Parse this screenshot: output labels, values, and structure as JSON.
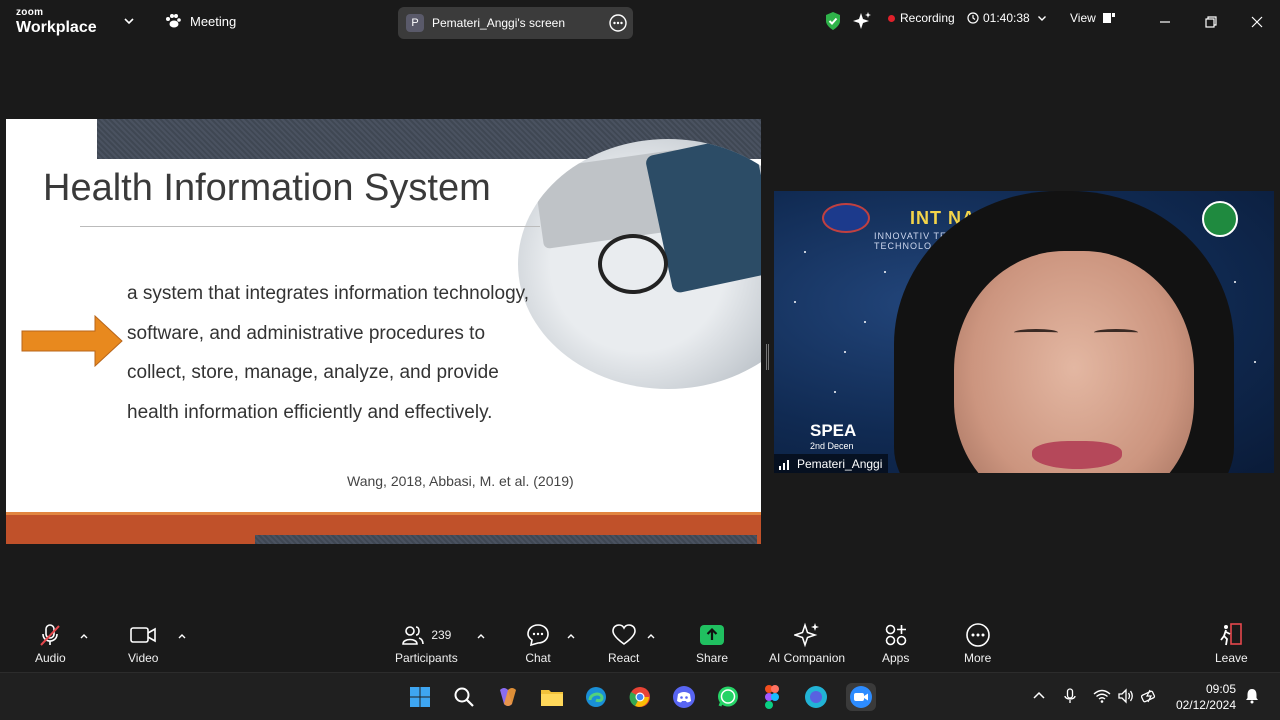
{
  "titlebar": {
    "brand_small": "zoom",
    "brand_large": "Workplace",
    "meeting_label": "Meeting",
    "screen_avatar_letter": "P",
    "screen_title": "Pemateri_Anggi's screen",
    "recording_label": "Recording",
    "timer": "01:40:38",
    "view_label": "View"
  },
  "slide": {
    "title": "Health Information System",
    "body_lines": [
      "a system that integrates information technology,",
      "software, and administrative procedures to",
      "collect, store, manage, analyze, and provide",
      "health information efficiently and effectively."
    ],
    "citation": "Wang, 2018, Abbasi, M. et al. (2019)"
  },
  "video": {
    "participant_name": "Pemateri_Anggi",
    "banner_text": "INT            NAR",
    "banner_sub": "INNOVATIV              TEGRATING",
    "banner_sub2": "TECHNOLO                  H SERVICES",
    "spea_text": "SPEA",
    "spea_sub": "2nd Decen"
  },
  "toolbar": {
    "audio": "Audio",
    "video": "Video",
    "participants": "Participants",
    "participants_count": "239",
    "chat": "Chat",
    "react": "React",
    "share": "Share",
    "ai_companion": "AI Companion",
    "apps": "Apps",
    "more": "More",
    "leave": "Leave"
  },
  "taskbar": {
    "time": "09:05",
    "date": "02/12/2024"
  },
  "colors": {
    "share_green": "#20c060",
    "record_red": "#e0202a",
    "shield_green": "#2fb34a",
    "leave_red": "#e5484d",
    "slide_orange": "#e28540"
  }
}
